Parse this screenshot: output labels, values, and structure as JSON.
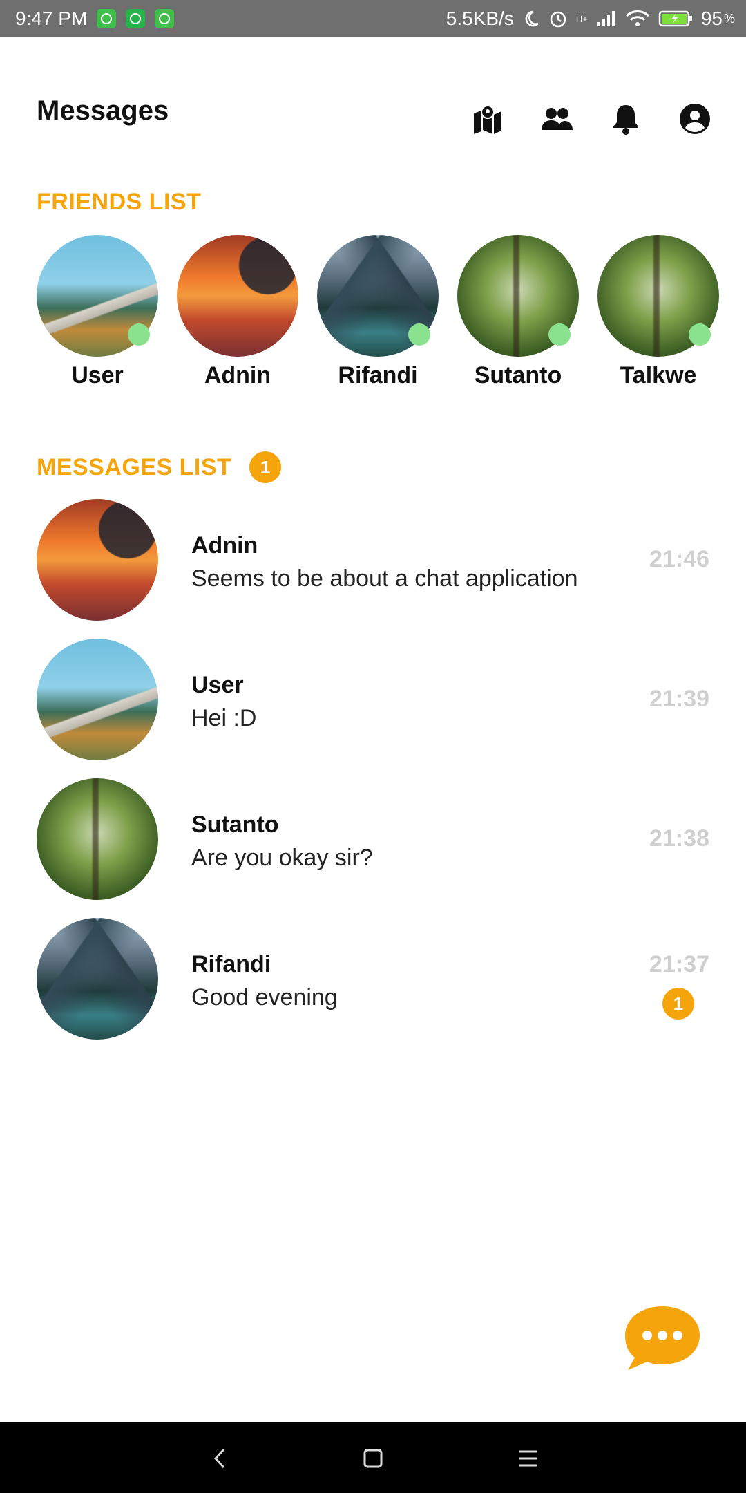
{
  "status_bar": {
    "time": "9:47 PM",
    "net_speed": "5.5KB/s",
    "network_type": "H+",
    "battery": "95",
    "battery_unit": "%",
    "app_icons": [
      "app-icon",
      "whatsapp-icon",
      "app-icon"
    ]
  },
  "header": {
    "title": "Messages",
    "icons": [
      "map-icon",
      "friends-icon",
      "bell-icon",
      "account-icon"
    ]
  },
  "friends": {
    "title": "FRIENDS LIST",
    "items": [
      {
        "name": "User",
        "online": true,
        "scene": "road"
      },
      {
        "name": "Adnin",
        "online": false,
        "scene": "sunset"
      },
      {
        "name": "Rifandi",
        "online": true,
        "scene": "mountain"
      },
      {
        "name": "Sutanto",
        "online": true,
        "scene": "forest"
      },
      {
        "name": "Talkwe",
        "online": true,
        "scene": "forest"
      }
    ]
  },
  "messages": {
    "title": "MESSAGES LIST",
    "badge": "1",
    "items": [
      {
        "name": "Adnin",
        "text": "Seems to be about a chat application",
        "time": "21:46",
        "badge": null,
        "scene": "sunset"
      },
      {
        "name": "User",
        "text": "Hei :D",
        "time": "21:39",
        "badge": null,
        "scene": "road"
      },
      {
        "name": "Sutanto",
        "text": "Are you okay sir?",
        "time": "21:38",
        "badge": null,
        "scene": "forest"
      },
      {
        "name": "Rifandi",
        "text": "Good evening",
        "time": "21:37",
        "badge": "1",
        "scene": "mountain"
      }
    ]
  },
  "fab": {
    "icon": "chat-bubble-icon"
  },
  "nav": {
    "icons": [
      "back-icon",
      "home-icon",
      "menu-icon"
    ]
  },
  "colors": {
    "accent": "#f5a50b",
    "online": "#8be28e",
    "time": "#cfcfcf"
  }
}
